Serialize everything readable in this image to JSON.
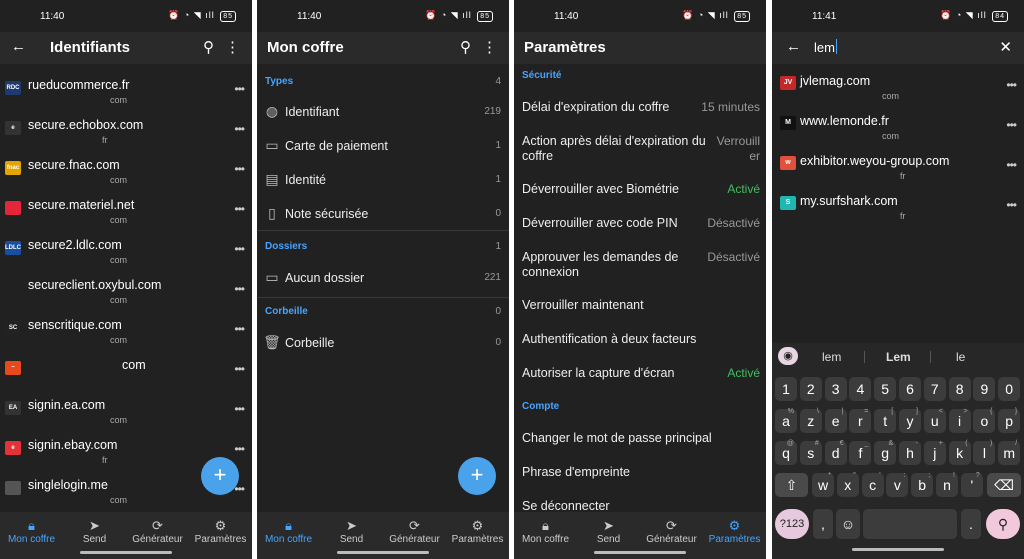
{
  "screen1": {
    "time": "11:40",
    "battery": "85",
    "title": "Identifiants",
    "items": [
      {
        "name": "rueducommerce.fr",
        "sub": "com",
        "badge": "RDC",
        "color": "#1f3a6e"
      },
      {
        "name": "secure.echobox.com",
        "sub": "fr",
        "badge": "e",
        "color": "#333333"
      },
      {
        "name": "secure.fnac.com",
        "sub": "com",
        "badge": "fnac",
        "color": "#e1a400"
      },
      {
        "name": "secure.materiel.net",
        "sub": "com",
        "badge": "",
        "color": "#e3263a"
      },
      {
        "name": "secure2.ldlc.com",
        "sub": "com",
        "badge": "LDLC",
        "color": "#1a4fa0"
      },
      {
        "name": "secureclient.oxybul.com",
        "sub": "com",
        "badge": "",
        "color": "#212121"
      },
      {
        "name": "senscritique.com",
        "sub": "com",
        "badge": "SC",
        "color": "#222222"
      },
      {
        "name": "com",
        "sub": "",
        "badge": "~",
        "color": "#e8491d"
      },
      {
        "name": "signin.ea.com",
        "sub": "com",
        "badge": "EA",
        "color": "#333333"
      },
      {
        "name": "signin.ebay.com",
        "sub": "fr",
        "badge": "e",
        "color": "#e53238"
      },
      {
        "name": "singlelogin.me",
        "sub": "com",
        "badge": "",
        "color": "#555555"
      }
    ],
    "nav": [
      "Mon coffre",
      "Send",
      "Générateur",
      "Paramètres"
    ]
  },
  "screen2": {
    "time": "11:40",
    "battery": "85",
    "title": "Mon coffre",
    "types_label": "Types",
    "types_count": "4",
    "types": [
      {
        "label": "Identifiant",
        "count": "219",
        "icon": "globe-icon",
        "glyph": "◍"
      },
      {
        "label": "Carte de paiement",
        "count": "1",
        "icon": "card-icon",
        "glyph": "▭"
      },
      {
        "label": "Identité",
        "count": "1",
        "icon": "id-card-icon",
        "glyph": "▤"
      },
      {
        "label": "Note sécurisée",
        "count": "0",
        "icon": "note-icon",
        "glyph": "▯"
      }
    ],
    "folders_label": "Dossiers",
    "folders_count": "1",
    "folder": {
      "label": "Aucun dossier",
      "count": "221"
    },
    "trash_label": "Corbeille",
    "trash_count": "0",
    "trash": {
      "label": "Corbeille",
      "count": "0"
    },
    "nav": [
      "Mon coffre",
      "Send",
      "Générateur",
      "Paramètres"
    ]
  },
  "screen3": {
    "time": "11:40",
    "title": "Paramètres",
    "security_label": "Sécurité",
    "security": [
      {
        "label": "Délai d'expiration du coffre",
        "value": "15 minutes",
        "on": false
      },
      {
        "label": "Action après délai d'expiration du coffre",
        "value": "Verrouiller",
        "on": false
      },
      {
        "label": "Déverrouiller avec Biométrie",
        "value": "Activé",
        "on": true
      },
      {
        "label": "Déverrouiller avec code PIN",
        "value": "Désactivé",
        "on": false
      },
      {
        "label": "Approuver les demandes de connexion",
        "value": "Désactivé",
        "on": false
      },
      {
        "label": "Verrouiller maintenant",
        "value": "",
        "on": false
      },
      {
        "label": "Authentification à deux facteurs",
        "value": "",
        "on": false
      },
      {
        "label": "Autoriser la capture d'écran",
        "value": "Activé",
        "on": true
      }
    ],
    "account_label": "Compte",
    "account": [
      {
        "label": "Changer le mot de passe principal"
      },
      {
        "label": "Phrase d'empreinte"
      },
      {
        "label": "Se déconnecter"
      }
    ],
    "nav": [
      "Mon coffre",
      "Send",
      "Générateur",
      "Paramètres"
    ]
  },
  "screen4": {
    "time": "11:41",
    "battery": "84",
    "query": "lem",
    "results": [
      {
        "name": "jvlemag.com",
        "sub": "com",
        "badge": "JV",
        "color": "#c62828"
      },
      {
        "name": "www.lemonde.fr",
        "sub": "com",
        "badge": "M",
        "color": "#111111"
      },
      {
        "name": "exhibitor.weyou-group.com",
        "sub": "fr",
        "badge": "w",
        "color": "#e0503a"
      },
      {
        "name": "my.surfshark.com",
        "sub": "fr",
        "badge": "S",
        "color": "#1eb8b0"
      }
    ],
    "suggestions": [
      "lem",
      "Lem",
      "le"
    ],
    "keys_row1": [
      "1",
      "2",
      "3",
      "4",
      "5",
      "6",
      "7",
      "8",
      "9",
      "0"
    ],
    "keys_row2": [
      "a",
      "z",
      "e",
      "r",
      "t",
      "y",
      "u",
      "i",
      "o",
      "p"
    ],
    "keys_row2_alt": [
      "%",
      "\\",
      "|",
      "=",
      "[",
      "]",
      "<",
      ">",
      "{",
      "}"
    ],
    "keys_row3": [
      "q",
      "s",
      "d",
      "f",
      "g",
      "h",
      "j",
      "k",
      "l",
      "m"
    ],
    "keys_row3_alt": [
      "@",
      "#",
      "€",
      "_",
      "&",
      "-",
      "+",
      "(",
      ")",
      "/"
    ],
    "keys_row4": [
      "w",
      "x",
      "c",
      "v",
      "b",
      "n",
      "'"
    ],
    "keys_row4_alt": [
      "*",
      "\"",
      "'",
      ":",
      ";",
      "!",
      "?"
    ],
    "symbols_key": "?123",
    "comma_key": ",",
    "period_key": "."
  }
}
